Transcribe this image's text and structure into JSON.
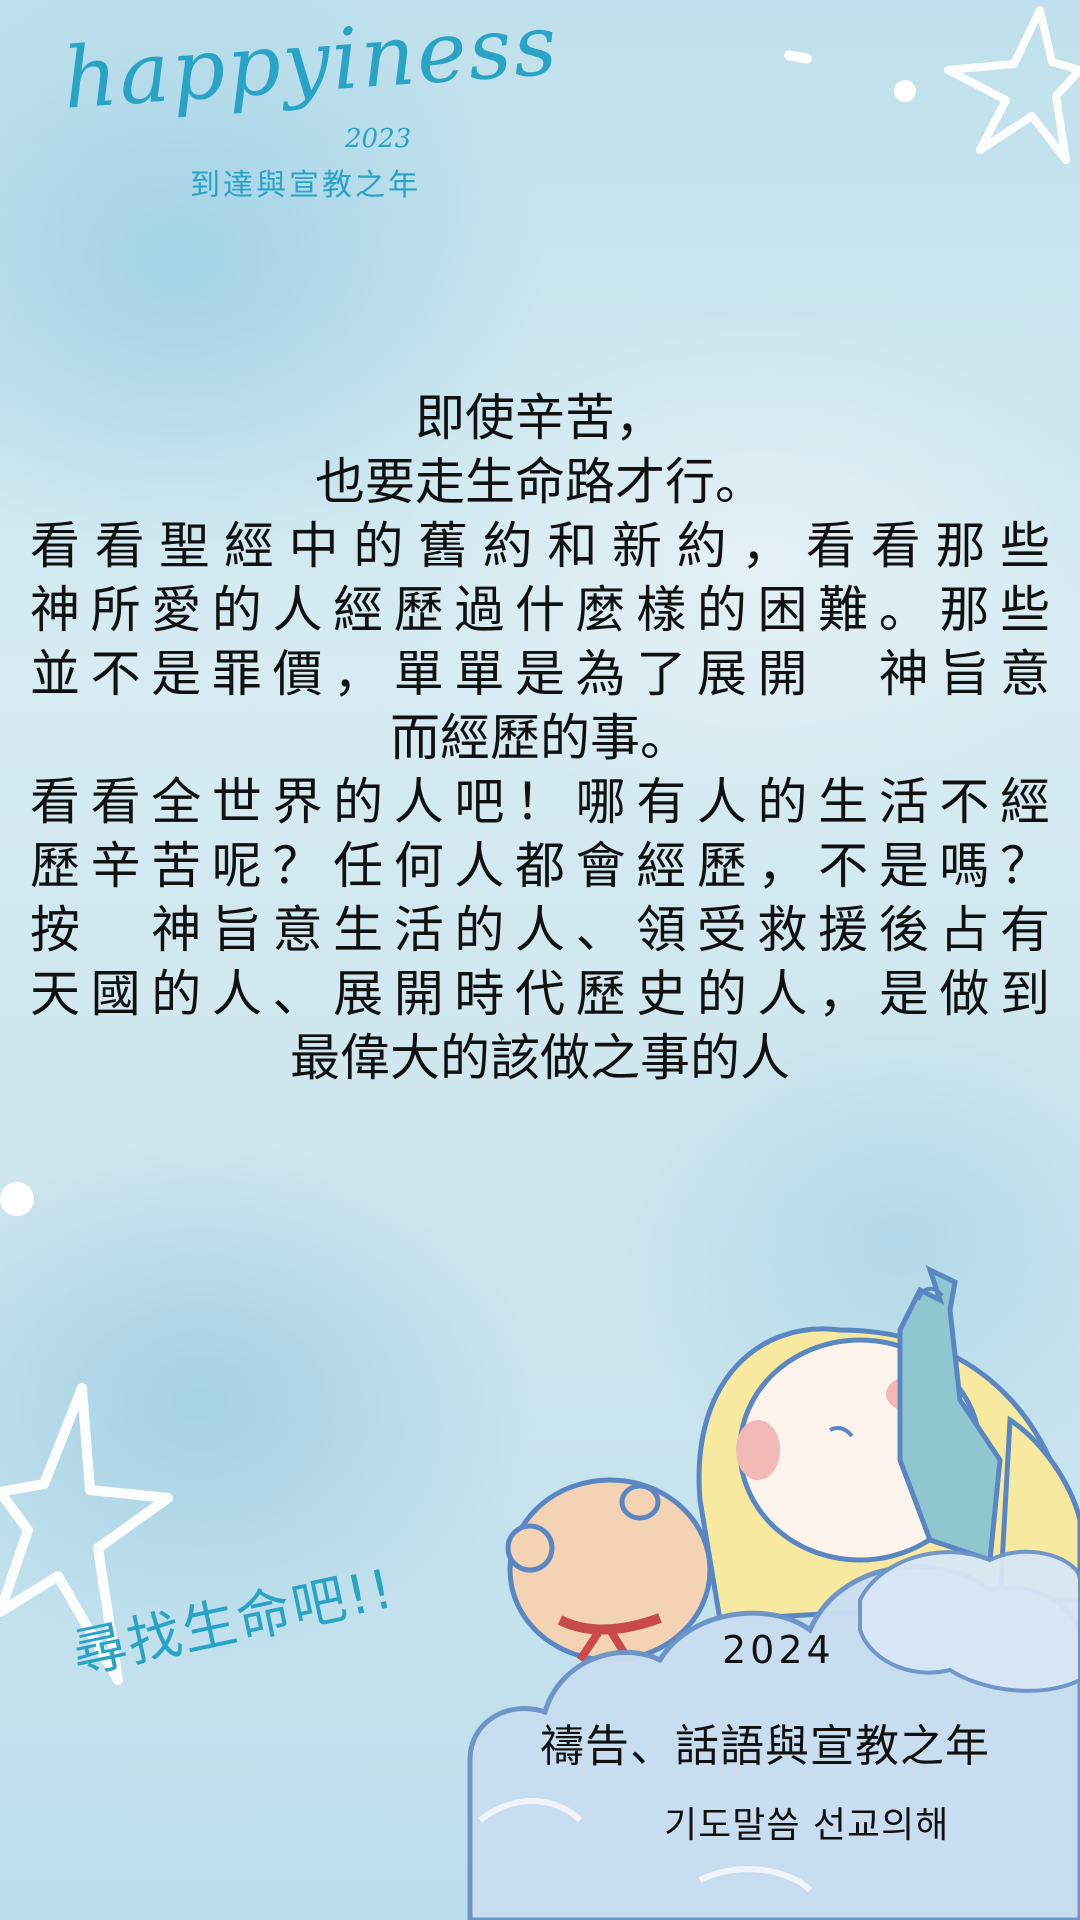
{
  "logo": {
    "word": "happyiness",
    "year": "2023",
    "subtitle": "到達與宣教之年"
  },
  "message": {
    "lines": [
      "即使辛苦，",
      "也要走生命路才行。",
      "看看聖經中的舊約和新約，看看那些",
      "神所愛的人經歷過什麼樣的困難。那些",
      "並不是罪價，單單是為了展開　神旨意",
      "而經歷的事。",
      "看看全世界的人吧！哪有人的生活不經",
      "歷辛苦呢？任何人都會經歷，不是嗎？",
      "按　神旨意生活的人、領受救援後占有",
      "天國的人、展開時代歷史的人，是做到",
      "最偉大的該做之事的人"
    ]
  },
  "slogan": "尋找生命吧!!",
  "footer": {
    "year": "2024",
    "theme_zh": "禱告、話語與宣教之年",
    "theme_ko": "기도말씀 선교의해"
  },
  "colors": {
    "accent": "#2aa3c4",
    "text": "#111111",
    "background": "#cfe6ef"
  }
}
